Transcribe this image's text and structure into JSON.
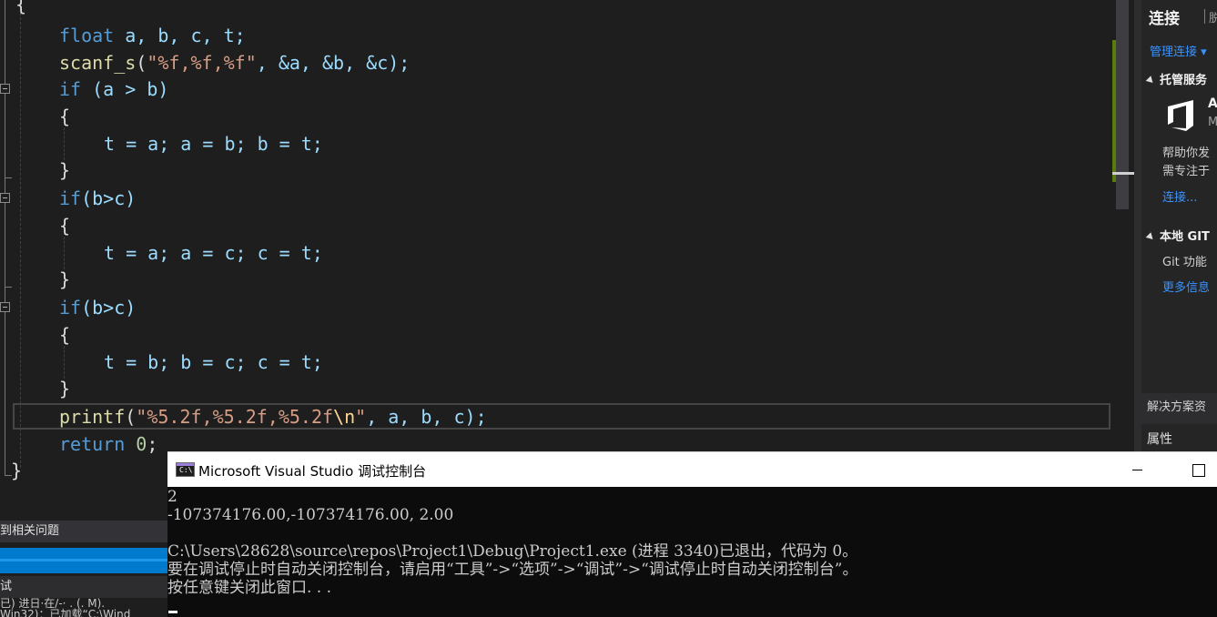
{
  "editor": {
    "open_brace": "{",
    "close_brace": "}",
    "decl": {
      "type": "float",
      "vars": "a, b, c, t;"
    },
    "scanf": {
      "fn": "scanf_s",
      "open": "(",
      "fmt": "\"%f,%f,%f\"",
      "args": ", &a, &b, &c);"
    },
    "if1": {
      "kw": "if",
      "cond": " (a > b)"
    },
    "if2": {
      "kw": "if",
      "cond": "(b>c)"
    },
    "if3": {
      "kw": "if",
      "cond": "(b>c)"
    },
    "swap1": "t = a; a = b; b = t;",
    "swap2": "t = a; a = c; c = t;",
    "swap3": "t = b; b = c; c = t;",
    "printf": {
      "fn": "printf",
      "open": "(",
      "fmt": "\"%5.2f,%5.2f,%5.2f",
      "esc": "\\n",
      "fmt_end": "\"",
      "args": ", a, b, c);"
    },
    "ret": {
      "kw": "return",
      "val": "0",
      "end": ";"
    }
  },
  "team_explorer": {
    "title": "连接",
    "offline": "脱机",
    "manage_connections": "管理连接 ▾",
    "hosted_section": "托管服务",
    "devops_name": "A",
    "devops_sub": "M",
    "help_line1": "帮助你发",
    "help_line2": "需专注于",
    "connect_link": "连接...",
    "local_git_section": "本地 GIT",
    "git_text": "Git 功能",
    "more_info": "更多信息",
    "solution_explorer": "解决方案资",
    "properties": "属性"
  },
  "output_panel": {
    "find_related": "到相关问题",
    "debug_tab": "试",
    "line1": "已)  进日·在/-· . (. M).",
    "line2": "Win32)：已加载“C:\\Wind"
  },
  "console": {
    "title": "Microsoft Visual Studio 调试控制台",
    "icon_text": "C:\\",
    "lines": [
      "2",
      "-107374176.00,-107374176.00, 2.00",
      "",
      "C:\\Users\\28628\\source\\repos\\Project1\\Debug\\Project1.exe (进程 3340)已退出，代码为 0。",
      "要在调试停止时自动关闭控制台，请启用“工具”->“选项”->“调试”->“调试停止时自动关闭控制台”。",
      "按任意键关闭此窗口. . ."
    ]
  }
}
